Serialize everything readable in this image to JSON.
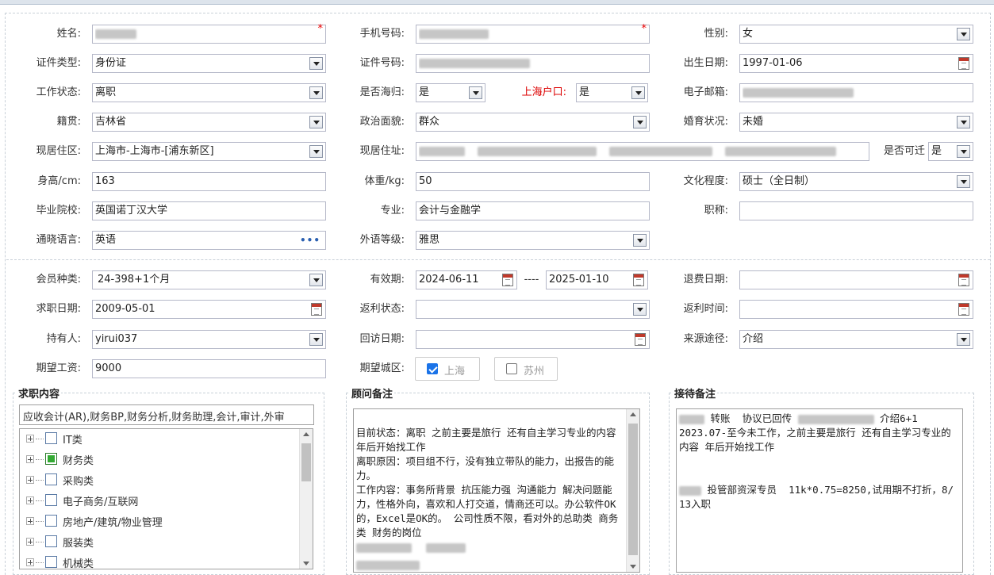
{
  "labels": {
    "name": "姓名:",
    "mobile": "手机号码:",
    "gender": "性别:",
    "id_type": "证件类型:",
    "id_number": "证件号码:",
    "birth_date": "出生日期:",
    "work_status": "工作状态:",
    "overseas": "是否海归:",
    "shanghai_hukou": "上海户口:",
    "email": "电子邮箱:",
    "native_place": "籍贯:",
    "political": "政治面貌:",
    "marital": "婚育状况:",
    "residence_area": "现居住区:",
    "residence_address": "现居住址:",
    "relocate": "是否可迁",
    "height": "身高/cm:",
    "weight": "体重/kg:",
    "education": "文化程度:",
    "school": "毕业院校:",
    "major": "专业:",
    "title": "职称:",
    "language": "通晓语言:",
    "language_level": "外语等级:",
    "member_type": "会员种类:",
    "valid_period": "有效期:",
    "refund_date": "退费日期:",
    "job_date": "求职日期:",
    "rebate_status": "返利状态:",
    "rebate_time": "返利时间:",
    "holder": "持有人:",
    "revisit_date": "回访日期:",
    "source": "来源途径:",
    "expected_salary": "期望工资:",
    "expected_city": "期望城区:",
    "range_sep": "----"
  },
  "values": {
    "gender": "女",
    "id_type": "身份证",
    "birth_date": "1997-01-06",
    "work_status": "离职",
    "overseas": "是",
    "shanghai_hukou": "是",
    "native_place": "吉林省",
    "political": "群众",
    "marital": "未婚",
    "residence_area": "上海市-上海市-[浦东新区]",
    "relocate": "是",
    "height": "163",
    "weight": "50",
    "education": "硕士（全日制）",
    "school": "英国诺丁汉大学",
    "major": "会计与金融学",
    "title": "",
    "language": "英语",
    "language_level": "雅思",
    "member_type": "24-398+1个月",
    "valid_from": "2024-06-11",
    "valid_to": "2025-01-10",
    "refund_date": "",
    "job_date": "2009-05-01",
    "rebate_status": "",
    "rebate_time": "",
    "holder": "yirui037",
    "revisit_date": "",
    "source": "介绍",
    "expected_salary": "9000"
  },
  "required_mark": "*",
  "cities": [
    {
      "label": "上海",
      "checked": true
    },
    {
      "label": "苏州",
      "checked": false
    }
  ],
  "job_panel": {
    "title": "求职内容",
    "summary": "应收会计(AR),财务BP,财务分析,财务助理,会计,审计,外审",
    "tree": [
      {
        "label": "IT类",
        "checked": false
      },
      {
        "label": "财务类",
        "checked": true
      },
      {
        "label": "采购类",
        "checked": false
      },
      {
        "label": "电子商务/互联网",
        "checked": false
      },
      {
        "label": "房地产/建筑/物业管理",
        "checked": false
      },
      {
        "label": "服装类",
        "checked": false
      },
      {
        "label": "机械类",
        "checked": false
      }
    ]
  },
  "advisor_panel": {
    "title": "顾问备注",
    "text": "目前状态：离职 之前主要是旅行 还有自主学习专业的内容 年后开始找工作\n离职原因：项目组不行，没有独立带队的能力，出报告的能力。\n工作内容：事务所背景 抗压能力强 沟通能力 解决问题能力，性格外向，喜欢和人打交道，情商还可以。办公软件OK的，Excel是OK的。 公司性质不限，看对外的总助类 商务类 财务的岗位"
  },
  "reception_panel": {
    "title": "接待备注",
    "line1_a": "转账  协议已回传",
    "line1_b": "介绍6+1",
    "line2": "2023.07-至今未工作，之前主要是旅行 还有自主学习专业的内容 年后开始找工作",
    "line3": "投管部资深专员  11k*0.75=8250,试用期不打折，8/13入职"
  }
}
